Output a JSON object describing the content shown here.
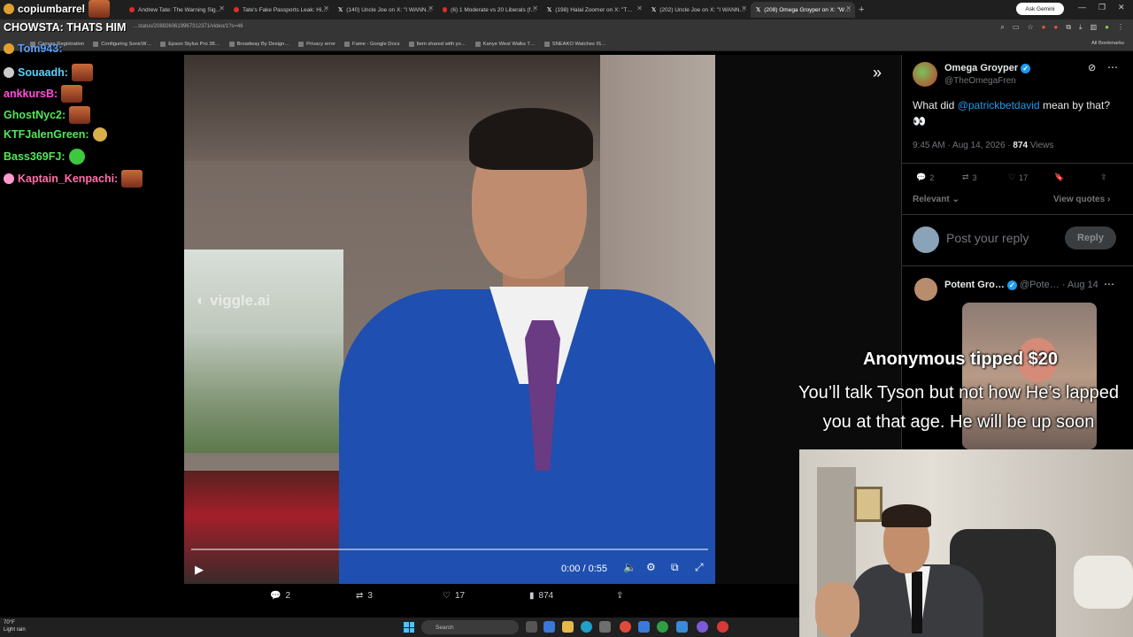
{
  "browser": {
    "tabs": [
      {
        "title": "Andrew Tate: The Warning Sig…",
        "type": "youtube"
      },
      {
        "title": "Tate's Fake Passports Leak: Hi…",
        "type": "youtube"
      },
      {
        "title": "(140) Uncle Joe on X: \"I WANN…",
        "type": "x"
      },
      {
        "title": "(6) 1 Moderate vs 20 Liberals (f…",
        "type": "youtube"
      },
      {
        "title": "(198) Halal Zoomer on X: \"T…",
        "type": "x"
      },
      {
        "title": "(202) Uncle Joe on X: \"I WANN…",
        "type": "x"
      },
      {
        "title": "(208) Omega Groyper on X: \"W…",
        "type": "x",
        "active": true
      }
    ],
    "ask_gemini": "Ask Gemini",
    "url": "…status/2089260619967312371/video/1?s=46",
    "bookmarks": [
      "Canvas Registration",
      "Configuring SonicW…",
      "Epson Stylus Pro 38…",
      "Broadway By Design…",
      "Privacy error",
      "Fame - Google Docs",
      "Item shared with yo…",
      "Kanye West Walks T…",
      "SNEAKO Watches IS…"
    ],
    "all_bookmarks": "All Bookmarks"
  },
  "chat": {
    "header_user": "copiumbarrel",
    "header_message": "CHOWSTA: THATS HIM",
    "lines": [
      {
        "user": "Tom943:",
        "color": "#5aa0ff"
      },
      {
        "user": "Souaadh:",
        "color": "#5ad0ff"
      },
      {
        "user": "ankkursB:",
        "color": "#ff4fd8"
      },
      {
        "user": "GhostNyc2:",
        "color": "#54e65a"
      },
      {
        "user": "KTFJalenGreen:",
        "color": "#54e65a"
      },
      {
        "user": "Bass369FJ:",
        "color": "#54e65a"
      },
      {
        "user": "Kaptain_Kenpachi:",
        "color": "#ff6fa8"
      }
    ]
  },
  "video": {
    "watermark": "viggle.ai",
    "time": "0:00 / 0:55",
    "progress": 0
  },
  "post_actions": {
    "replies": "2",
    "reposts": "3",
    "likes": "17",
    "views": "874"
  },
  "tweet": {
    "author": "Omega Groyper",
    "handle": "@TheOmegaFren",
    "text_before": "What did ",
    "mention": "@patrickbetdavid",
    "text_after": " mean by that? 👀",
    "time": "9:45 AM · Aug 14, 2026 · ",
    "views_count": "874",
    "views_label": " Views",
    "stats": {
      "replies": "2",
      "reposts": "3",
      "likes": "17"
    },
    "relevant": "Relevant",
    "view_quotes": "View quotes",
    "reply_placeholder": "Post your reply",
    "reply_button": "Reply"
  },
  "reply2": {
    "author": "Potent Gro…",
    "handle": "@Pote… · Aug 14"
  },
  "tip": {
    "title": "Anonymous tipped $20",
    "message": "You’ll talk Tyson but not how He’s lapped you at that age. He will be up soon"
  },
  "taskbar": {
    "temp": "70°F",
    "condition": "Light rain",
    "search": "Search"
  },
  "colors": {
    "x_blue": "#1d9bf0",
    "suit_blue": "#1f4fb0",
    "tip_text": "#ffffff"
  }
}
